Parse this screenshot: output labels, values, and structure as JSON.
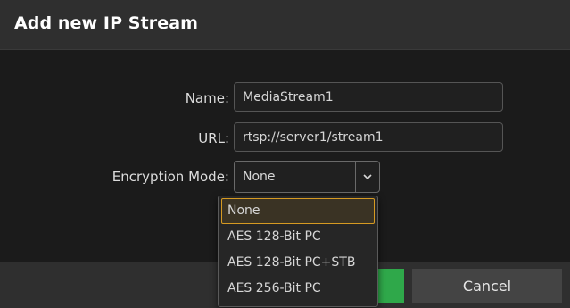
{
  "dialog": {
    "title": "Add new IP Stream"
  },
  "form": {
    "name_label": "Name:",
    "name_value": "MediaStream1",
    "url_label": "URL:",
    "url_value": "rtsp://server1/stream1",
    "encryption_label": "Encryption Mode:",
    "encryption_value": "None"
  },
  "dropdown": {
    "options": [
      {
        "label": "None",
        "selected": true
      },
      {
        "label": "AES 128-Bit PC",
        "selected": false
      },
      {
        "label": "AES 128-Bit PC+STB",
        "selected": false
      },
      {
        "label": "AES 256-Bit PC",
        "selected": false
      }
    ]
  },
  "footer": {
    "cancel_label": "Cancel"
  },
  "colors": {
    "ok_button": "#2fa84a",
    "selection_border": "#d69a22",
    "title_bar": "#2f2f2f"
  },
  "icons": {
    "select_toggle": "chevron-down-icon"
  }
}
